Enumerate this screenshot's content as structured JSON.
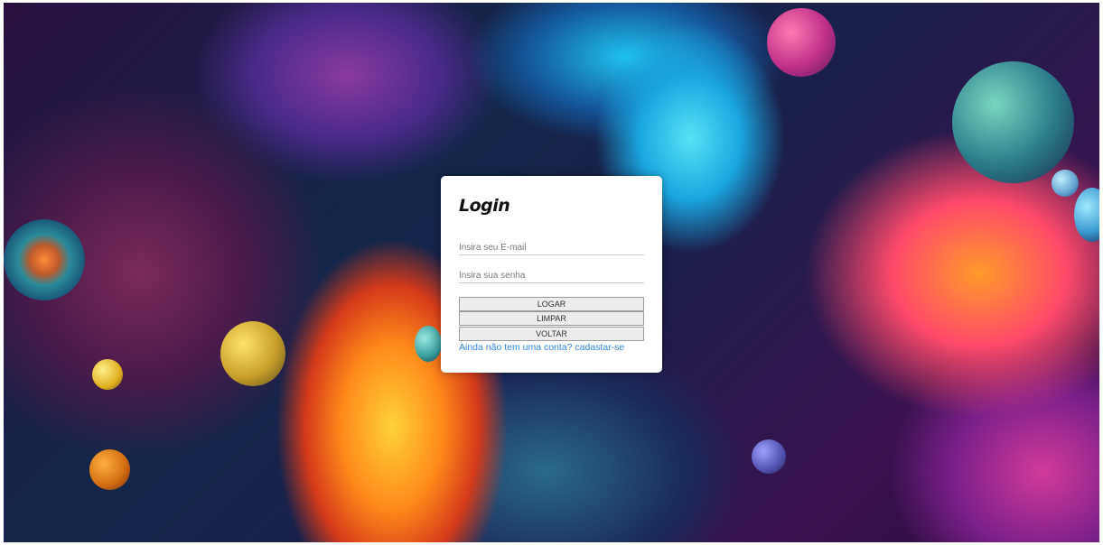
{
  "login": {
    "title": "Login",
    "email_placeholder": "Insira seu E-mail",
    "password_placeholder": "Insira sua senha",
    "login_button": "LOGAR",
    "clear_button": "LIMPAR",
    "back_button": "VOLTAR",
    "signup_link": "Ainda não tem uma conta? cadastar-se"
  },
  "colors": {
    "card_bg": "#ffffff",
    "link": "#2e86e6",
    "button_bg": "#ededed",
    "button_border": "#9a9a9a"
  }
}
